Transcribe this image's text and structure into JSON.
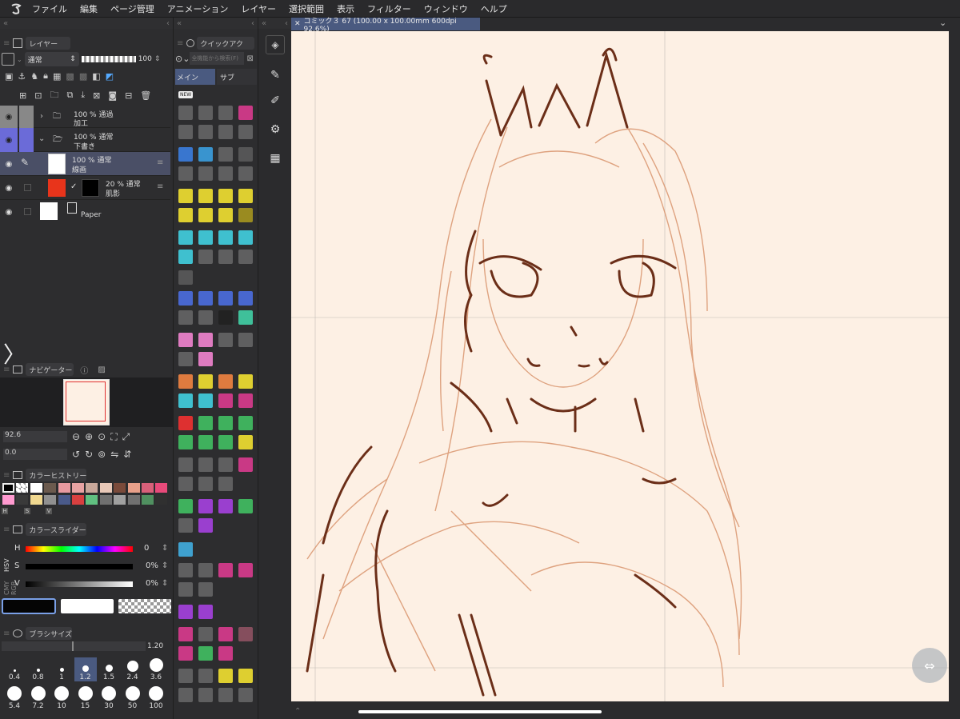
{
  "menu": {
    "items": [
      "ファイル",
      "編集",
      "ページ管理",
      "アニメーション",
      "レイヤー",
      "選択範囲",
      "表示",
      "フィルター",
      "ウィンドウ",
      "ヘルプ"
    ]
  },
  "layer_panel": {
    "title": "レイヤー",
    "blend_mode": "通常",
    "opacity": "100",
    "layers": [
      {
        "opacity": "100 % 通過",
        "name": "加工"
      },
      {
        "opacity": "100 % 通常",
        "name": "下書き"
      },
      {
        "opacity": "100 % 通常",
        "name": "線画"
      },
      {
        "opacity": "20 % 通常",
        "name": "肌影"
      },
      {
        "opacity": "",
        "name": "Paper"
      }
    ]
  },
  "quick_access": {
    "title": "クイックアク",
    "search_placeholder": "全機能から検索(F)",
    "tab_main": "メイン",
    "tab_sub": "サブ",
    "new_badge": "NEW"
  },
  "navigator": {
    "title": "ナビゲーター",
    "zoom": "92.6",
    "rotation": "0.0"
  },
  "color_history": {
    "title": "カラーヒストリー",
    "tabs": [
      "H",
      "S",
      "V"
    ],
    "colors": [
      "#000000",
      "#ffffff",
      "#ffffff",
      "#6b5a4e",
      "#e89aa0",
      "#e8a3a3",
      "#c9a89a",
      "#e8c8b8",
      "#7a4a3a",
      "#e8a08a",
      "#d9607a",
      "#e84a7a",
      "#ff9ad0",
      "#3a3a3a",
      "#f0d890",
      "#909090",
      "#4a5a8a",
      "#d84040",
      "#60c080",
      "#707070",
      "#a0a0a0",
      "#707070",
      "#509060",
      "#303030"
    ]
  },
  "color_slider": {
    "title": "カラースライダー",
    "modes": [
      "RGB",
      "HSV",
      "CMY"
    ],
    "rows": [
      {
        "label": "H",
        "value": "0"
      },
      {
        "label": "S",
        "value": "0%"
      },
      {
        "label": "V",
        "value": "0%"
      }
    ]
  },
  "brush_size": {
    "title": "ブラシサイズ",
    "value": "1.20",
    "sizes": [
      "0.4",
      "0.8",
      "1",
      "1.2",
      "1.5",
      "2.4",
      "3.6",
      "5.4",
      "7.2",
      "10",
      "15",
      "30",
      "50",
      "100"
    ]
  },
  "canvas": {
    "tab_title": "コミック３ 67 (100.00 x 100.00mm 600dpi 92.6%)",
    "bg_color": "#fdf0e4"
  }
}
